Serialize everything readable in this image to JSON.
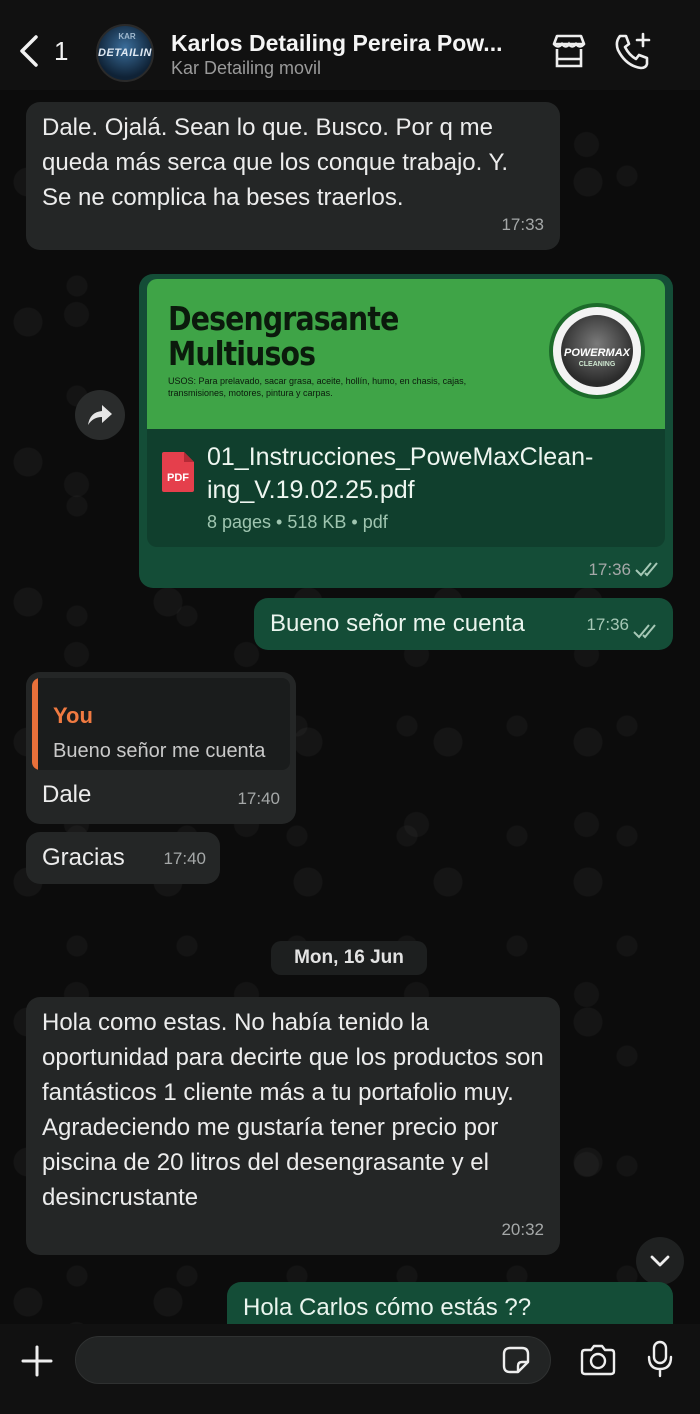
{
  "header": {
    "back_count": "1",
    "contact_name": "Karlos Detailing Pereira Pow...",
    "contact_subtitle": "Kar  Detailing movil",
    "avatar_text_top": "KAR",
    "avatar_text": "DETAILING",
    "icons": [
      "chevron-left-icon",
      "store-icon",
      "phone-add-icon"
    ]
  },
  "messages": [
    {
      "direction": "incoming",
      "text": "Dale. Ojalá. Sean lo que. Busco. Por q me queda más serca que los conque trabajo. Y. Se ne complica ha beses traerlos.",
      "time": "17:33"
    },
    {
      "direction": "outgoing",
      "type": "document",
      "preview_heading_line1": "Desengrasante",
      "preview_heading_line2": "Multiusos",
      "preview_usage": "USOS: Para prelavado, sacar grasa, aceite, hollín, humo, en chasis, cajas, transmisiones, motores, pintura y carpas.",
      "preview_logo_text": "POWERMAX",
      "preview_logo_sub": "CLEANING",
      "file_icon_label": "PDF",
      "file_name": "01_Instrucciones_PoweMaxClean-ing_V.19.02.25.pdf",
      "file_meta": "8 pages • 518 KB • pdf",
      "time": "17:36",
      "status": "read"
    },
    {
      "direction": "outgoing",
      "text": "Bueno señor me cuenta",
      "time": "17:36",
      "status": "read"
    },
    {
      "direction": "incoming",
      "quote_author": "You",
      "quote_text": "Bueno señor me cuenta",
      "text": "Dale",
      "time": "17:40"
    },
    {
      "direction": "incoming",
      "text": "Gracias",
      "time": "17:40"
    },
    {
      "direction": "incoming",
      "text": "Hola como estas.  No había tenido la oportunidad para decirte que los productos son fantásticos 1 cliente más a tu portafolio  muy. Agradeciendo me gustaría tener precio  por piscina de 20 litros del desengrasante y el desincrustante",
      "time": "20:32"
    },
    {
      "direction": "outgoing",
      "text": "Hola Carlos cómo estás ??"
    }
  ],
  "date_separator": "Mon, 16 Jun",
  "composer": {
    "input_value": "",
    "icons": [
      "plus-icon",
      "sticker-icon",
      "camera-icon",
      "microphone-icon"
    ]
  },
  "colors": {
    "incoming_bubble": "#242626",
    "outgoing_bubble": "#144d37",
    "doc_preview_green": "#3fa447",
    "quote_accent": "#f07a41"
  }
}
